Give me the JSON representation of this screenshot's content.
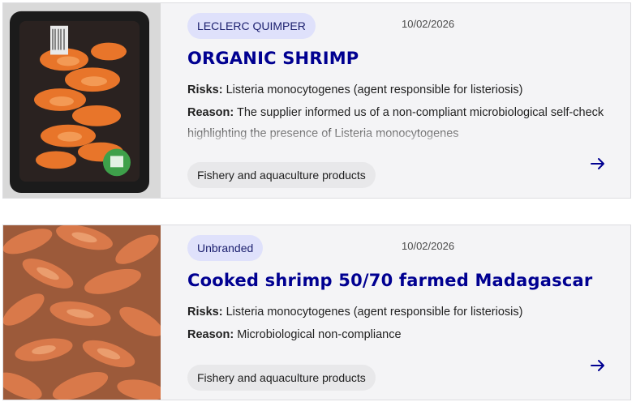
{
  "recalls": [
    {
      "brand": "LECLERC QUIMPER",
      "date": "10/02/2026",
      "title": "ORGANIC SHRIMP",
      "risks_label": "Risks:",
      "risks_value": "Listeria monocytogenes (agent responsible for listeriosis)",
      "reason_label": "Reason:",
      "reason_value": "The supplier informed us of a non-compliant microbiological self-check highlighting the presence of Listeria monocytogenes",
      "category": "Fishery and aquaculture products",
      "image": "organic-shrimp-package-photo"
    },
    {
      "brand": "Unbranded",
      "date": "10/02/2026",
      "title": "Cooked shrimp 50/70 farmed Madagascar",
      "risks_label": "Risks:",
      "risks_value": "Listeria monocytogenes (agent responsible for listeriosis)",
      "reason_label": "Reason:",
      "reason_value": "Microbiological non-compliance",
      "category": "Fishery and aquaculture products",
      "image": "cooked-shrimp-pile-photo"
    }
  ],
  "icons": {
    "open": "arrow-right-icon"
  },
  "colors": {
    "title": "#000091",
    "badge_bg": "#dfe1fb",
    "card_bg": "#f4f4f6"
  }
}
